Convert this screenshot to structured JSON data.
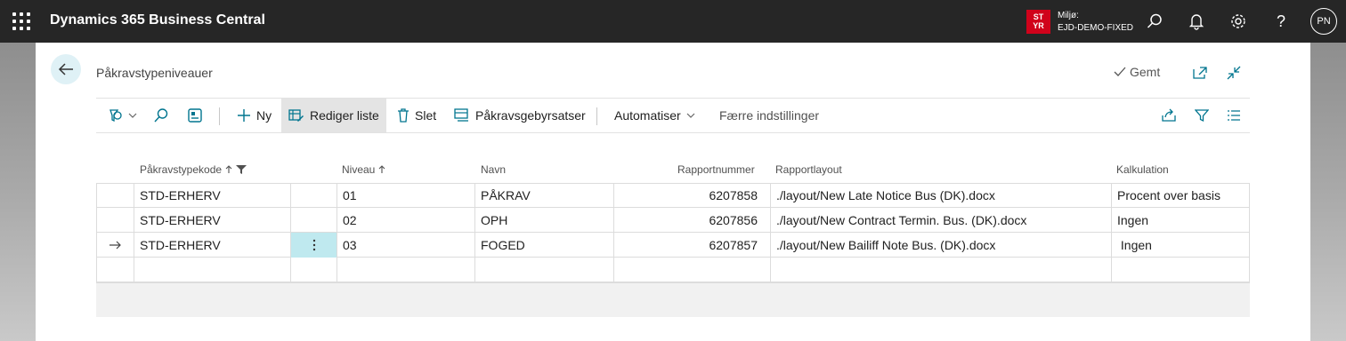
{
  "app": {
    "title": "Dynamics 365 Business Central",
    "env_badge_line1": "ST",
    "env_badge_line2": "YR",
    "env_label": "Miljø:",
    "env_name": "EJD-DEMO-FIXED",
    "user_initials": "PN",
    "colors": {
      "topbar": "#262626",
      "accent": "#00758f",
      "badge": "#d0021b",
      "selected_cell": "#bfe9ef"
    }
  },
  "page": {
    "title": "Påkravstypeniveauer",
    "saved_label": "Gemt"
  },
  "actions": {
    "new": "Ny",
    "edit_list": "Rediger liste",
    "delete": "Slet",
    "fee_rates": "Påkravsgebyrsatser",
    "automate": "Automatiser",
    "fewer_options": "Færre indstillinger"
  },
  "columns": {
    "code": "Påkravstypekode",
    "level": "Niveau",
    "name": "Navn",
    "report_number": "Rapportnummer",
    "report_layout": "Rapportlayout",
    "calculation": "Kalkulation"
  },
  "rows": [
    {
      "code": "STD-ERHERV",
      "level": "01",
      "name": "PÅKRAV",
      "report_number": "6207858",
      "report_layout": "./layout/New Late Notice Bus (DK).docx",
      "calculation": "Procent over basis"
    },
    {
      "code": "STD-ERHERV",
      "level": "02",
      "name": "OPH",
      "report_number": "6207856",
      "report_layout": "./layout/New Contract Termin. Bus. (DK).docx",
      "calculation": "Ingen"
    },
    {
      "code": "STD-ERHERV",
      "level": "03",
      "name": "FOGED",
      "report_number": "6207857",
      "report_layout": "./layout/New Bailiff Note Bus. (DK).docx",
      "calculation": " Ingen"
    },
    {
      "code": "",
      "level": "",
      "name": "",
      "report_number": "",
      "report_layout": "",
      "calculation": ""
    }
  ]
}
